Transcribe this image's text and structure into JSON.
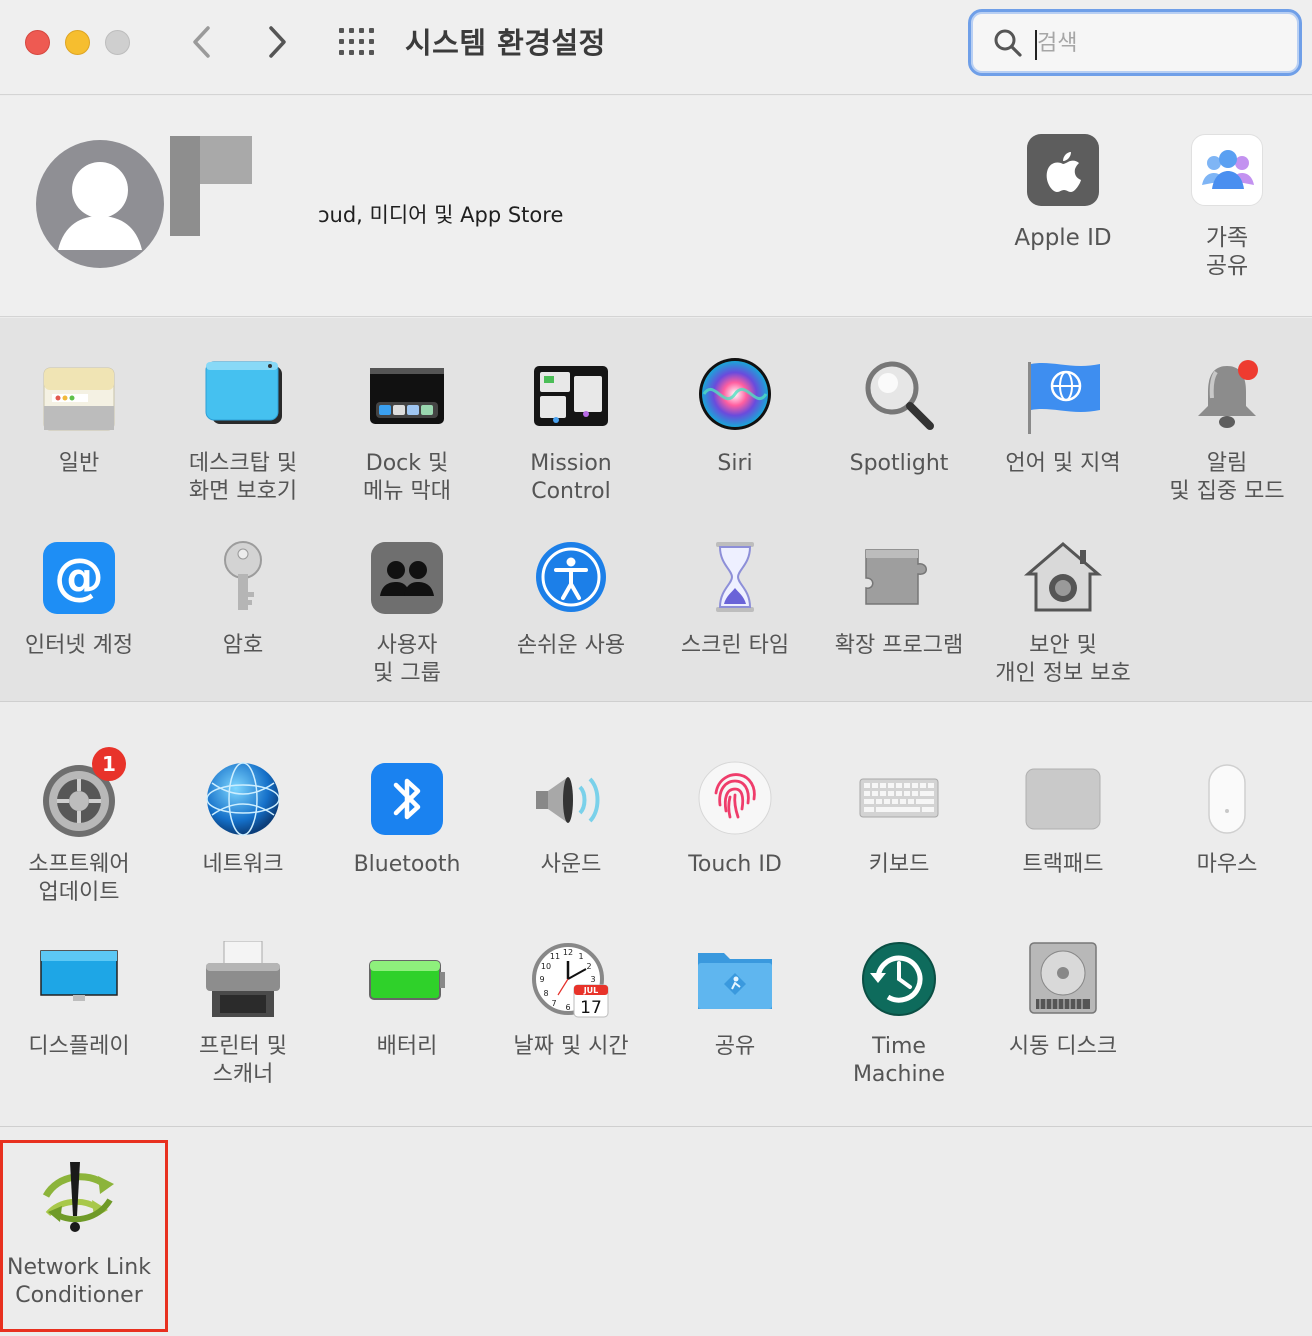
{
  "window": {
    "title": "시스템 환경설정",
    "search_placeholder": "검색"
  },
  "account": {
    "subtitle": "ɔud, 미디어 및 App Store",
    "items": [
      {
        "label": "Apple ID",
        "icon": "apple-icon"
      },
      {
        "label": "가족\n공유",
        "icon": "family-sharing-icon"
      }
    ]
  },
  "section1": [
    {
      "label": "일반",
      "icon": "general-icon"
    },
    {
      "label": "데스크탑 및\n화면 보호기",
      "icon": "desktop-screensaver-icon"
    },
    {
      "label": "Dock 및\n메뉴 막대",
      "icon": "dock-menubar-icon"
    },
    {
      "label": "Mission\nControl",
      "icon": "mission-control-icon"
    },
    {
      "label": "Siri",
      "icon": "siri-icon"
    },
    {
      "label": "Spotlight",
      "icon": "spotlight-icon"
    },
    {
      "label": "언어 및 지역",
      "icon": "language-region-icon"
    },
    {
      "label": "알림\n및 집중 모드",
      "icon": "notifications-icon"
    },
    {
      "label": "인터넷 계정",
      "icon": "internet-accounts-icon"
    },
    {
      "label": "암호",
      "icon": "passwords-icon"
    },
    {
      "label": "사용자\n및 그룹",
      "icon": "users-groups-icon"
    },
    {
      "label": "손쉬운 사용",
      "icon": "accessibility-icon"
    },
    {
      "label": "스크린 타임",
      "icon": "screen-time-icon"
    },
    {
      "label": "확장 프로그램",
      "icon": "extensions-icon"
    },
    {
      "label": "보안 및\n개인 정보 보호",
      "icon": "security-privacy-icon"
    }
  ],
  "section2": [
    {
      "label": "소프트웨어\n업데이트",
      "icon": "software-update-icon",
      "badge": "1"
    },
    {
      "label": "네트워크",
      "icon": "network-icon"
    },
    {
      "label": "Bluetooth",
      "icon": "bluetooth-icon"
    },
    {
      "label": "사운드",
      "icon": "sound-icon"
    },
    {
      "label": "Touch ID",
      "icon": "touch-id-icon"
    },
    {
      "label": "키보드",
      "icon": "keyboard-icon"
    },
    {
      "label": "트랙패드",
      "icon": "trackpad-icon"
    },
    {
      "label": "마우스",
      "icon": "mouse-icon"
    },
    {
      "label": "디스플레이",
      "icon": "displays-icon"
    },
    {
      "label": "프린터 및\n스캐너",
      "icon": "printers-scanners-icon"
    },
    {
      "label": "배터리",
      "icon": "battery-icon"
    },
    {
      "label": "날짜 및 시간",
      "icon": "date-time-icon",
      "calendar": {
        "month": "JUL",
        "day": "17"
      },
      "clock": {
        "numerals": [
          "12",
          "1",
          "2",
          "3",
          "4",
          "5",
          "6",
          "7",
          "8",
          "9",
          "10",
          "11"
        ]
      }
    },
    {
      "label": "공유",
      "icon": "sharing-icon"
    },
    {
      "label": "Time\nMachine",
      "icon": "time-machine-icon"
    },
    {
      "label": "시동 디스크",
      "icon": "startup-disk-icon"
    }
  ],
  "section3": [
    {
      "label": "Network Link\nConditioner",
      "icon": "network-link-conditioner-icon"
    }
  ],
  "colors": {
    "highlight_border": "#e8301f",
    "search_focus": "#6f9fe8",
    "badge": "#e8332a"
  }
}
